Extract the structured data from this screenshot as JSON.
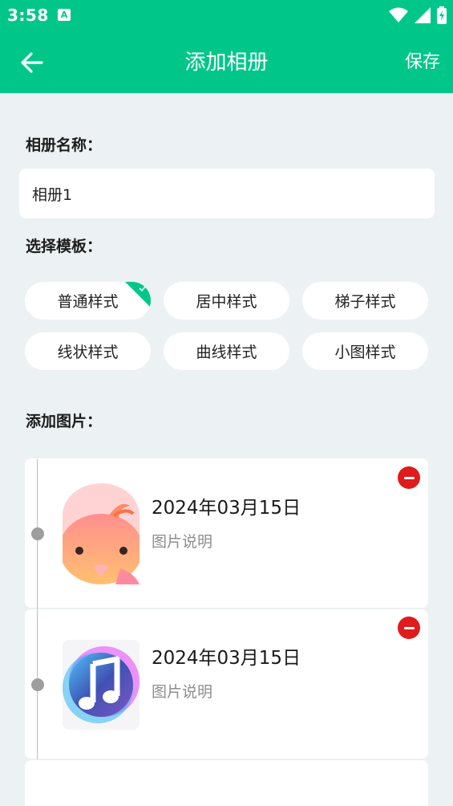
{
  "status_bar": {
    "time": "3:58",
    "notification_letter": "A"
  },
  "header": {
    "title": "添加相册",
    "save_label": "保存"
  },
  "album_name": {
    "label": "相册名称：",
    "value": "相册1"
  },
  "template": {
    "label": "选择模板：",
    "options": [
      "普通样式",
      "居中样式",
      "梯子样式",
      "线状样式",
      "曲线样式",
      "小图样式"
    ],
    "selected": "普通样式"
  },
  "photos": {
    "label": "添加图片：",
    "items": [
      {
        "date": "2024年03月15日",
        "caption": "图片说明",
        "image": "peach-face-icon"
      },
      {
        "date": "2024年03月15日",
        "caption": "图片说明",
        "image": "music-note-icon"
      }
    ]
  },
  "colors": {
    "accent": "#00c789",
    "remove": "#df1b1b",
    "background": "#ecf1f3"
  }
}
